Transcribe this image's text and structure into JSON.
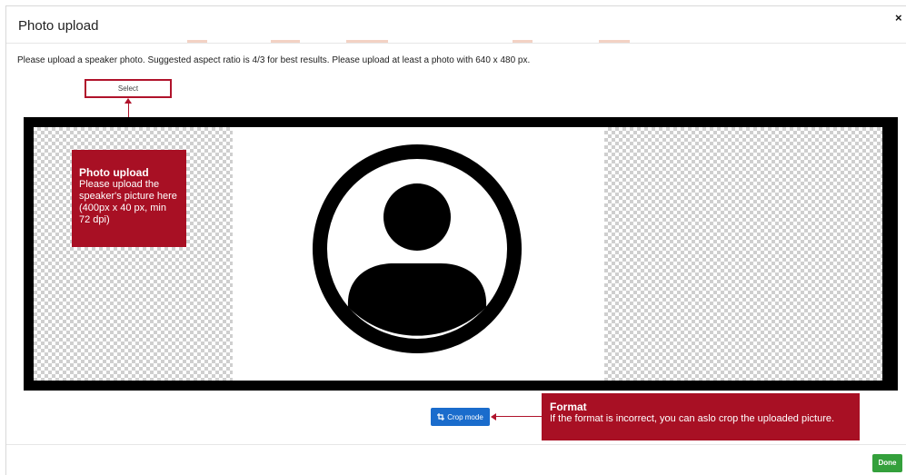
{
  "modal": {
    "title": "Photo upload",
    "close_icon": "×",
    "instructions": "Please upload a speaker photo. Suggested aspect ratio is 4/3 for best results. Please upload at least a photo with 640 x 480 px."
  },
  "select_button": {
    "label": "Select"
  },
  "callouts": {
    "upload": {
      "title": "Photo upload",
      "body": "Please upload the speaker's picture here (400px x 40 px, min 72 dpi)"
    },
    "format": {
      "title": "Format",
      "body": "If the format is incorrect, you can aslo crop the uploaded picture."
    }
  },
  "crop_button": {
    "icon": "crop-icon",
    "label": "Crop mode"
  },
  "done_button": {
    "label": "Done"
  },
  "colors": {
    "callout_red": "#a81024",
    "crop_blue": "#1a6ccc",
    "done_green": "#34a03c"
  }
}
